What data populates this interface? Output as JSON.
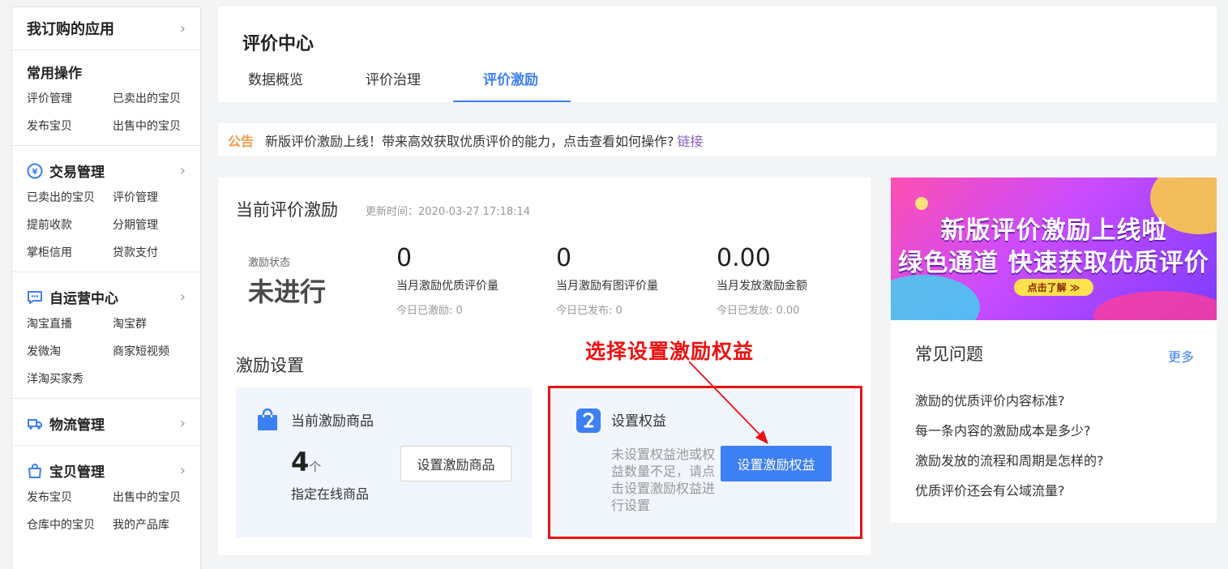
{
  "sidebar": {
    "head": "我订购的应用",
    "sections": [
      {
        "title": "常用操作",
        "links": [
          "评价管理",
          "已卖出的宝贝",
          "发布宝贝",
          "出售中的宝贝"
        ]
      },
      {
        "title": "交易管理",
        "icon": "yen-icon",
        "links": [
          "已卖出的宝贝",
          "评价管理",
          "提前收款",
          "分期管理",
          "掌柜信用",
          "贷款支付"
        ]
      },
      {
        "title": "自运营中心",
        "icon": "chat-icon",
        "links": [
          "淘宝直播",
          "淘宝群",
          "发微淘",
          "商家短视频",
          "洋淘买家秀"
        ]
      },
      {
        "title": "物流管理",
        "icon": "truck-icon",
        "links": []
      },
      {
        "title": "宝贝管理",
        "icon": "bag-icon",
        "links": [
          "发布宝贝",
          "出售中的宝贝",
          "仓库中的宝贝",
          "我的产品库"
        ]
      }
    ]
  },
  "header": {
    "title": "评价中心",
    "tabs": [
      "数据概览",
      "评价治理",
      "评价激励"
    ],
    "active_tab": 2
  },
  "notice": {
    "tag": "公告",
    "message": "新版评价激励上线！带来高效获取优质评价的能力，点击查看如何操作?",
    "link": "链接"
  },
  "incentive": {
    "title": "当前评价激励",
    "updated": "更新时间：2020-03-27 17:18:14",
    "status_label": "激励状态",
    "status_value": "未进行",
    "stats": [
      {
        "value": "0",
        "label": "当月激励优质评价量",
        "sub": "今日已激励: 0"
      },
      {
        "value": "0",
        "label": "当月激励有图评价量",
        "sub": "今日已发布: 0"
      },
      {
        "value": "0.00",
        "label": "当月发放激励金额",
        "sub": "今日已发放: 0.00"
      }
    ],
    "settings_title": "激励设置",
    "goods_card": {
      "title": "当前激励商品",
      "count": "4",
      "unit": "个",
      "desc": "指定在线商品",
      "button": "设置激励商品"
    },
    "rights_card": {
      "title": "设置权益",
      "hint": "未设置权益池或权益数量不足，请点击设置激励权益进行设置",
      "button": "设置激励权益"
    }
  },
  "annotation": {
    "text": "选择设置激励权益",
    "color": "#ee1111"
  },
  "banner": {
    "line1": "新版评价激励上线啦",
    "line2": "绿色通道 快速获取优质评价",
    "button": "点击了解 ≫"
  },
  "faq": {
    "title": "常见问题",
    "more": "更多",
    "items": [
      "激励的优质评价内容标准?",
      "每一条内容的激励成本是多少?",
      "激励发放的流程和周期是怎样的?",
      "优质评价还会有公域流量?"
    ]
  },
  "colors": {
    "accent": "#3d7ff5",
    "notice_tag": "#f09a4a",
    "link": "#8a5fc1"
  }
}
